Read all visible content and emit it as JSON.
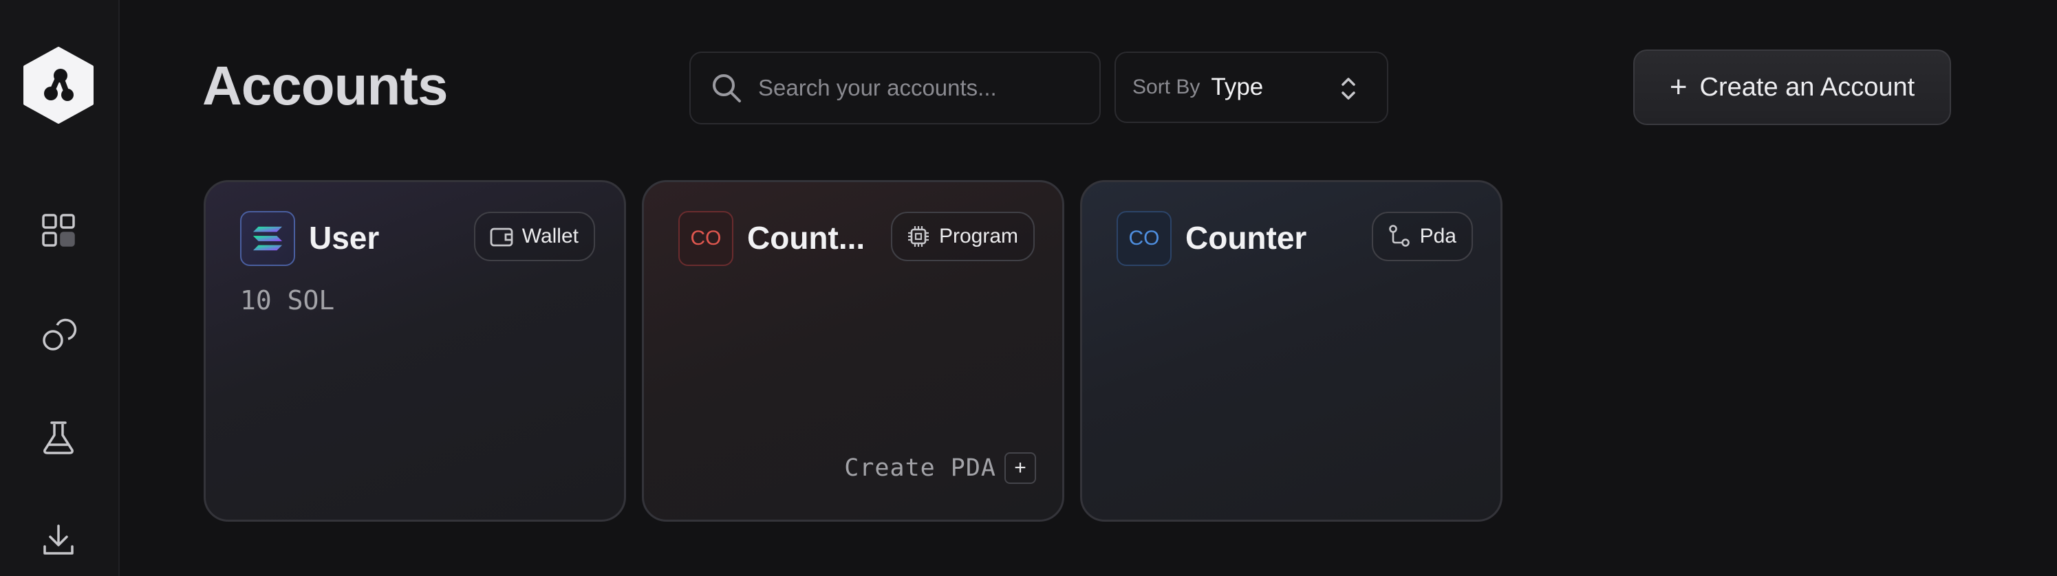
{
  "sidebar": {
    "logo": "app-logo",
    "items": [
      {
        "name": "dashboard",
        "icon": "grid-icon"
      },
      {
        "name": "accounts",
        "icon": "circles-icon"
      },
      {
        "name": "lab",
        "icon": "flask-icon"
      },
      {
        "name": "download",
        "icon": "download-icon"
      }
    ]
  },
  "header": {
    "title": "Accounts",
    "search": {
      "placeholder": "Search your accounts...",
      "value": ""
    },
    "sort": {
      "label": "Sort By",
      "value": "Type"
    },
    "create_button": {
      "icon": "+",
      "label": "Create an Account"
    }
  },
  "cards": [
    {
      "title": "User",
      "icon": "solana-icon",
      "badge": "Wallet",
      "badge_icon": "wallet-icon",
      "balance": "10 SOL",
      "accent": "#8b5cf6"
    },
    {
      "title": "Count...",
      "icon_text": "CO",
      "badge": "Program",
      "badge_icon": "chip-icon",
      "action": {
        "label": "Create PDA",
        "icon": "+"
      },
      "accent": "#e0574f"
    },
    {
      "title": "Counter",
      "icon_text": "CO",
      "badge": "Pda",
      "badge_icon": "branch-icon",
      "accent": "#4f8fe0"
    }
  ],
  "colors": {
    "background": "#121214",
    "sidebar": "#161618",
    "card_border": "#34343a"
  }
}
